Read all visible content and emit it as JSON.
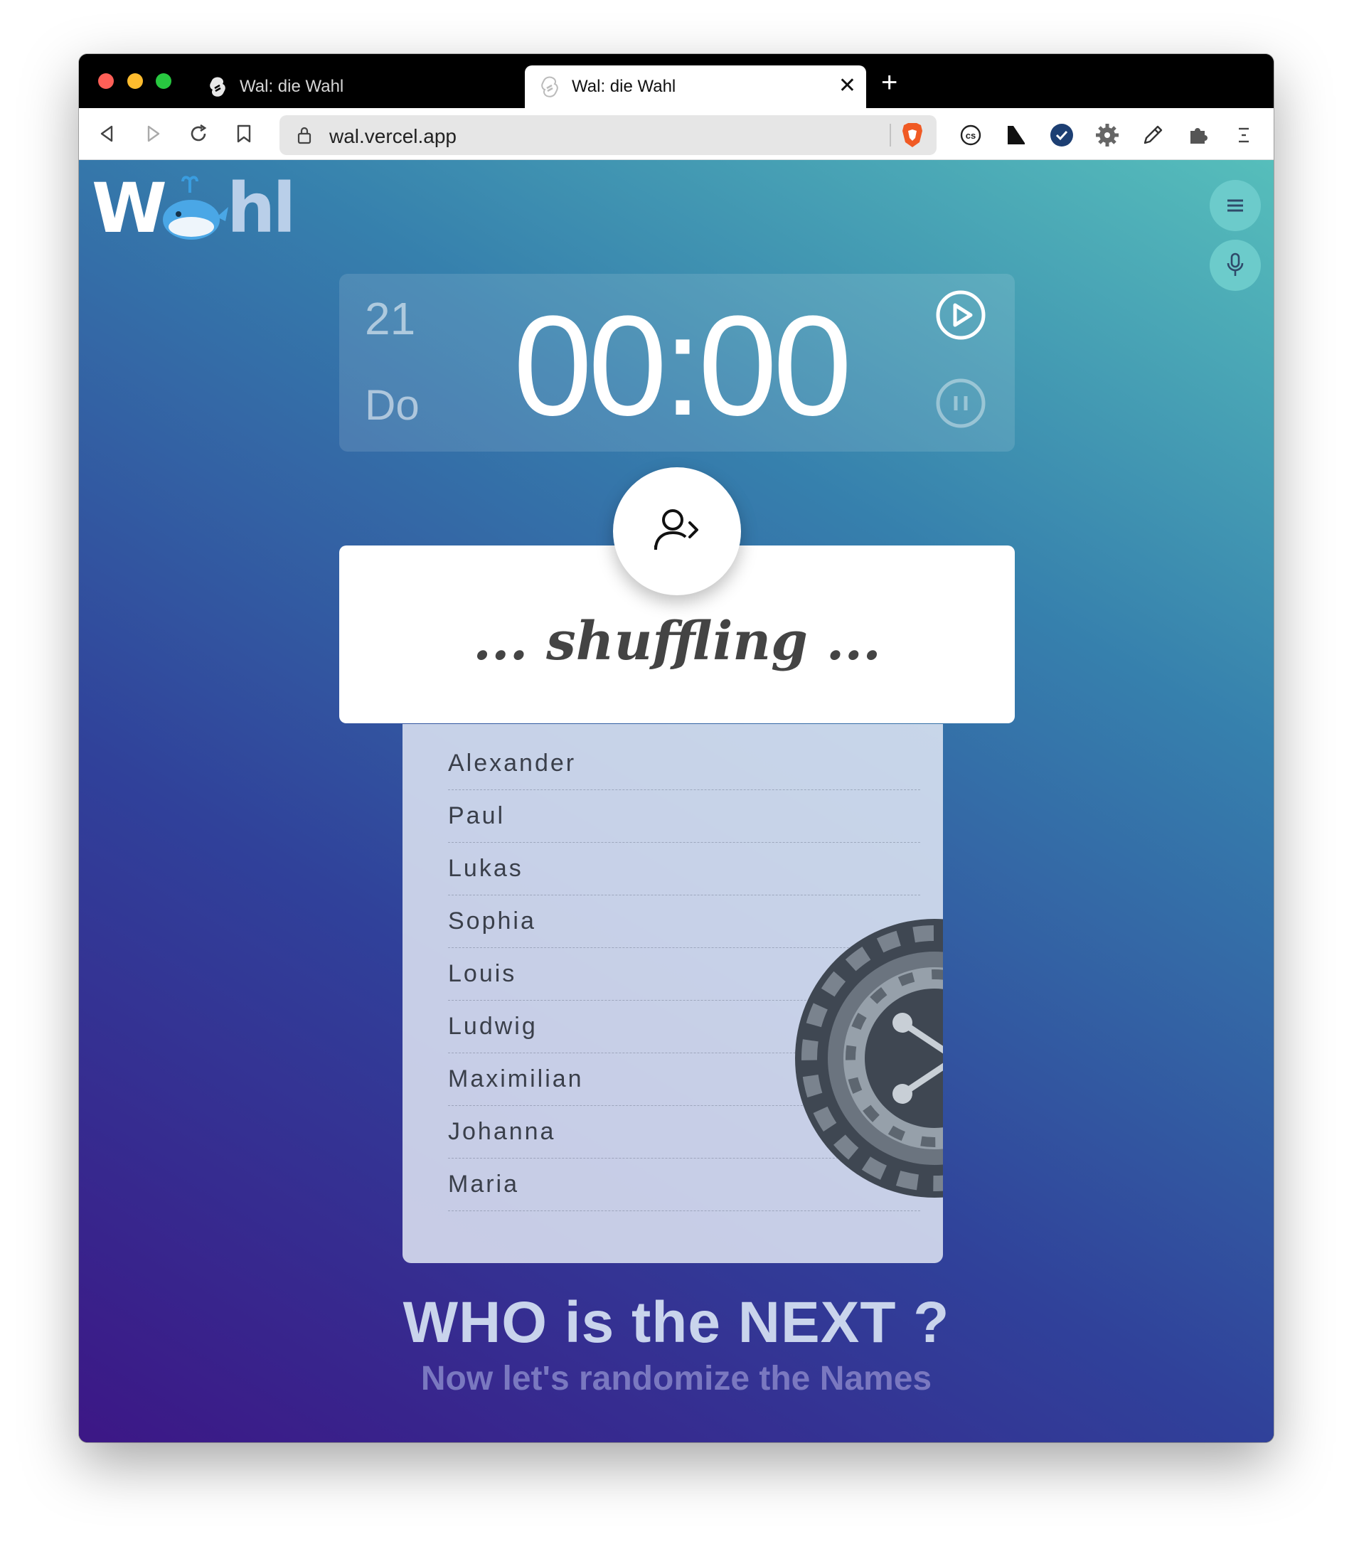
{
  "browser": {
    "tabs": [
      {
        "title": "Wal: die Wahl",
        "active": false
      },
      {
        "title": "Wal: die Wahl",
        "active": true
      }
    ],
    "url": "wal.vercel.app"
  },
  "app": {
    "logo_letters": {
      "w": "W",
      "rest": "hl"
    },
    "timer": {
      "day": "21",
      "weekday": "Do",
      "time": "00:00"
    },
    "status": "... shuffling ...",
    "names": [
      "Alexander",
      "Paul",
      "Lukas",
      "Sophia",
      "Louis",
      "Ludwig",
      "Maximilian",
      "Johanna",
      "Maria"
    ],
    "headline": "WHO is the NEXT ?",
    "subline": "Now let's randomize the Names"
  },
  "icons": {
    "menu": "hamburger-menu-icon",
    "mic": "microphone-icon",
    "play": "play-icon",
    "pause": "pause-icon",
    "next_user": "user-next-icon",
    "roulette": "roulette-wheel-icon"
  },
  "colors": {
    "gradient_start": "#3c1786",
    "gradient_mid": "#30419a",
    "gradient_end": "#56bebb",
    "side_button": "#6ccbcb",
    "headline": "#c9d4ec",
    "subline": "#7a78c0"
  }
}
